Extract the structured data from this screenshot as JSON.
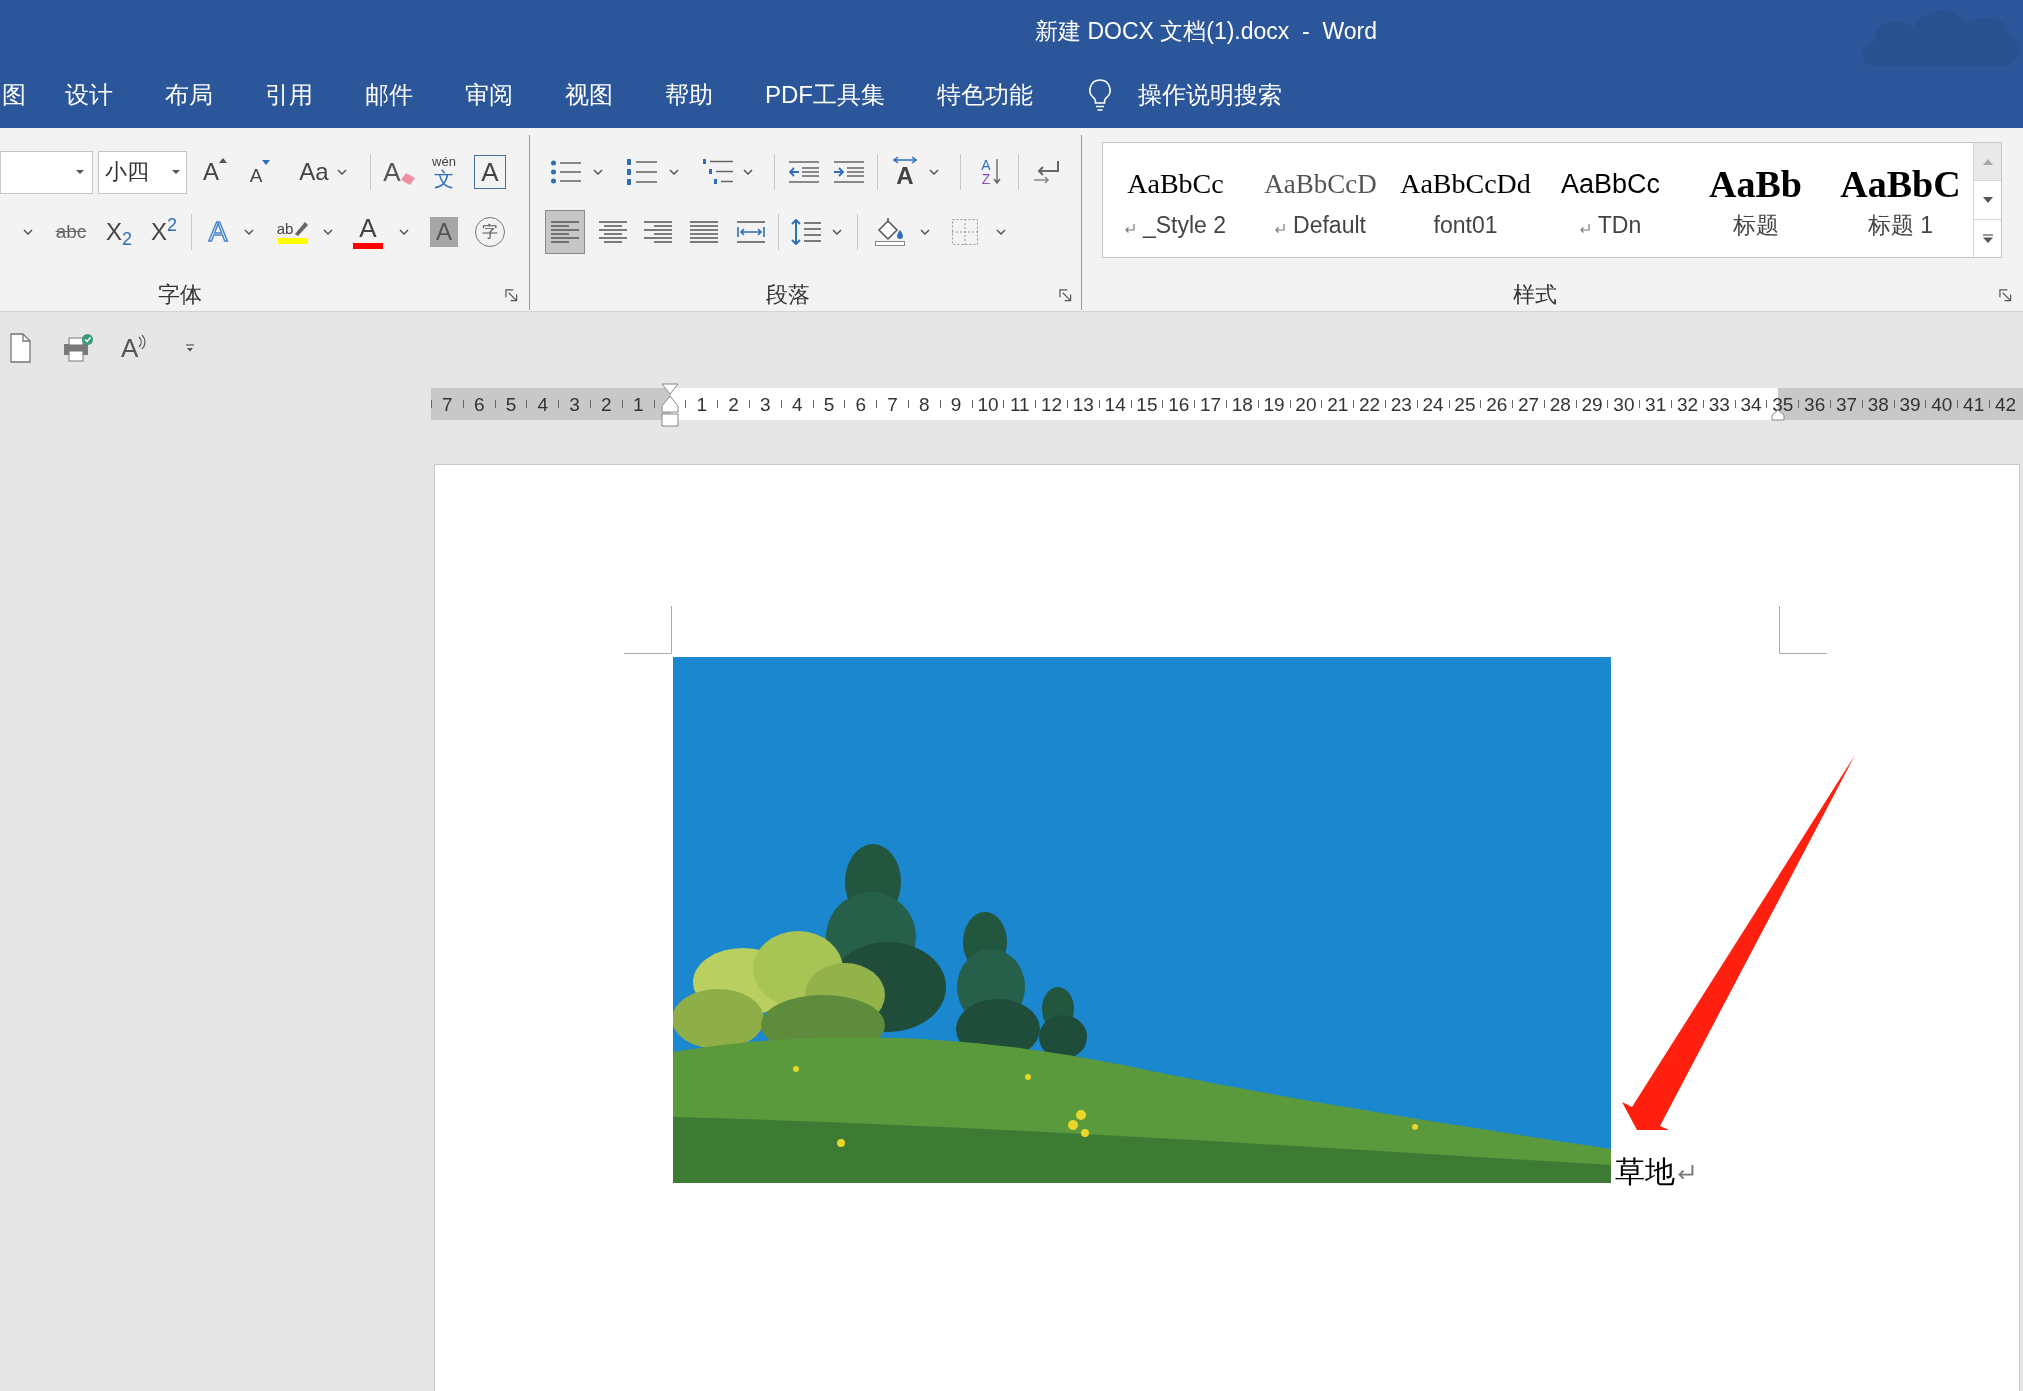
{
  "window": {
    "title": "新建 DOCX 文档(1).docx  -  Word"
  },
  "tabs": [
    {
      "label": "图",
      "selected": false
    },
    {
      "label": "设计",
      "selected": false
    },
    {
      "label": "布局",
      "selected": false
    },
    {
      "label": "引用",
      "selected": false
    },
    {
      "label": "邮件",
      "selected": false
    },
    {
      "label": "审阅",
      "selected": false
    },
    {
      "label": "视图",
      "selected": false
    },
    {
      "label": "帮助",
      "selected": false
    },
    {
      "label": "PDF工具集",
      "selected": false
    },
    {
      "label": "特色功能",
      "selected": false
    }
  ],
  "tell_me": {
    "placeholder": "操作说明搜索"
  },
  "ribbon": {
    "font_group": {
      "label": "字体",
      "font_size": "小四",
      "row_1": [
        {
          "kind": "grow_font",
          "glyph": "A"
        },
        {
          "kind": "shrink_font",
          "glyph": "A"
        },
        {
          "kind": "change_case",
          "glyph": "Aa"
        },
        {
          "kind": "clear_formatting",
          "glyph": "A"
        },
        {
          "kind": "phonetic_guide",
          "glyph": "文",
          "ruby": "wén"
        },
        {
          "kind": "character_border",
          "glyph": "A"
        }
      ],
      "row_2": [
        {
          "kind": "underline"
        },
        {
          "kind": "strikethrough",
          "glyph": "abc"
        },
        {
          "kind": "subscript",
          "glyph": "X$_{2}$"
        },
        {
          "kind": "superscript",
          "glyph": "X$^{2}$"
        },
        {
          "kind": "text_effects",
          "glyph": "A"
        },
        {
          "kind": "highlight",
          "glyph": "ab",
          "color": "#ffff00"
        },
        {
          "kind": "font_color",
          "glyph": "A",
          "color": "#ff0000"
        },
        {
          "kind": "character_shading",
          "glyph": "A"
        },
        {
          "kind": "enclose_characters",
          "glyph": "字"
        }
      ]
    },
    "paragraph_group": {
      "label": "段落",
      "row_1": [
        {
          "kind": "bullets"
        },
        {
          "kind": "numbering"
        },
        {
          "kind": "multilevel_list"
        },
        {
          "kind": "decrease_indent"
        },
        {
          "kind": "increase_indent"
        },
        {
          "kind": "asian_layout",
          "glyph": "A"
        },
        {
          "kind": "sort",
          "glyph": "A",
          "glyph_2": "Z"
        },
        {
          "kind": "show_marks"
        }
      ],
      "row_2": [
        {
          "kind": "align_left",
          "selected": true
        },
        {
          "kind": "align_center",
          "selected": false
        },
        {
          "kind": "align_right",
          "selected": false
        },
        {
          "kind": "justify",
          "selected": false
        },
        {
          "kind": "distributed",
          "selected": false
        },
        {
          "kind": "line_spacing"
        },
        {
          "kind": "shading"
        },
        {
          "kind": "borders"
        }
      ]
    },
    "styles_group": {
      "label": "样式",
      "styles": [
        {
          "kind": "serif",
          "preview": "AaBbCc",
          "label": "_Style 2",
          "paragraph_mark": true,
          "selected": false
        },
        {
          "kind": "serif_light",
          "preview": "AaBbCcD",
          "label": "Default",
          "paragraph_mark": true,
          "selected": false
        },
        {
          "kind": "serif",
          "preview": "AaBbCcDd",
          "label": "font01",
          "paragraph_mark": false,
          "selected": false
        },
        {
          "kind": "sans",
          "preview": "AaBbCc",
          "label": "TDn",
          "paragraph_mark": true,
          "selected": false
        },
        {
          "kind": "heading",
          "preview": "AaBb",
          "label": "标题",
          "paragraph_mark": false,
          "selected": false
        },
        {
          "kind": "heading",
          "preview": "AaBbC",
          "label": "标题 1",
          "paragraph_mark": false,
          "selected": false
        }
      ]
    }
  },
  "quick_access": [
    {
      "kind": "new_document"
    },
    {
      "kind": "print_preview"
    },
    {
      "kind": "read_aloud",
      "glyph": "A"
    },
    {
      "kind": "customize"
    }
  ],
  "ruler": {
    "left_numbers": [
      "7",
      "6",
      "5",
      "4",
      "3",
      "2",
      "1"
    ],
    "numbers": [
      "1",
      "2",
      "3",
      "4",
      "5",
      "6",
      "7",
      "8",
      "9",
      "10",
      "11",
      "12",
      "13",
      "14",
      "15",
      "16",
      "17",
      "18",
      "19",
      "20",
      "21",
      "22",
      "23",
      "24",
      "25",
      "26",
      "27",
      "28",
      "29",
      "30",
      "31",
      "32",
      "33",
      "34"
    ],
    "right_numbers": [
      "35",
      "36",
      "37",
      "38",
      "39",
      "40",
      "41",
      "42"
    ]
  },
  "document": {
    "caption": "草地",
    "paragraph_mark": true
  }
}
